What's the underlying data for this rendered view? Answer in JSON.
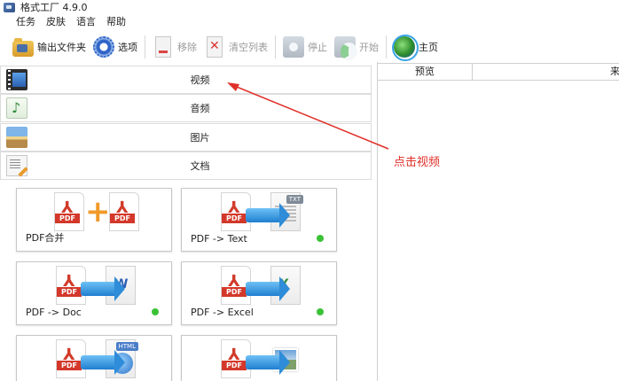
{
  "window": {
    "title": "格式工厂 4.9.0"
  },
  "menu": [
    "任务",
    "皮肤",
    "语言",
    "帮助"
  ],
  "toolbar": {
    "output_folder": "输出文件夹",
    "options": "选项",
    "remove": "移除",
    "clear_list": "清空列表",
    "stop": "停止",
    "start": "开始",
    "home": "主页"
  },
  "categories": {
    "video": "视频",
    "audio": "音频",
    "image": "图片",
    "document": "文档"
  },
  "tiles": [
    {
      "label": "PDF合并",
      "status_dot": false
    },
    {
      "label": "PDF -> Text",
      "status_dot": true
    },
    {
      "label": "PDF -> Doc",
      "status_dot": true
    },
    {
      "label": "PDF -> Excel",
      "status_dot": true
    },
    {
      "label": "",
      "status_dot": false
    },
    {
      "label": "",
      "status_dot": false
    }
  ],
  "tile_badges": {
    "text": "TXT",
    "word": "W",
    "excel": "X",
    "html": "HTML"
  },
  "pdf_badge": "PDF",
  "table": {
    "col_preview": "预览",
    "col_source": "来"
  },
  "annotation": {
    "text": "点击视频",
    "color": "#e0302a"
  },
  "colors": {
    "status_dot": "#3ac236",
    "pdf_red": "#d3382a",
    "accent_blue": "#2f8cd8"
  }
}
